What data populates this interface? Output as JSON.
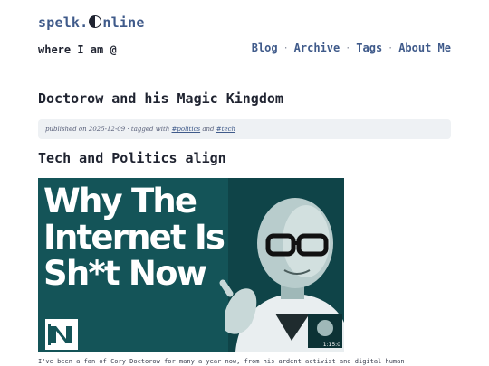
{
  "site": {
    "title_prefix": "spelk.",
    "title_suffix": "nline",
    "logo_icon": "yin-yang-icon",
    "tagline": "where I am @"
  },
  "nav": {
    "items": [
      "Blog",
      "Archive",
      "Tags",
      "About Me"
    ],
    "separator": "·"
  },
  "post": {
    "title": "Doctorow and his Magic Kingdom",
    "meta": {
      "published_label": "published on",
      "date": "2025-12-09",
      "separator": "·",
      "tagged_label": "tagged with",
      "tags": [
        "#politics",
        "#tech"
      ],
      "and_label": "and"
    },
    "section_heading": "Tech and Politics align",
    "hero": {
      "headline": "Why The\nInternet Is\nSh*t Now",
      "logo_text": "N",
      "duration": "1:15:0",
      "background_color": "#145458"
    },
    "intro_text": "I've been a fan of Cory Doctorow for many a year now, from his ardent activist and digital human"
  }
}
